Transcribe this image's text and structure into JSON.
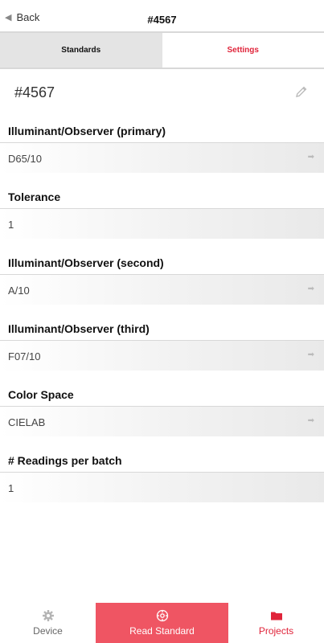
{
  "header": {
    "back_label": "Back",
    "title": "#4567"
  },
  "tabs": [
    {
      "label": "Standards",
      "active": false
    },
    {
      "label": "Settings",
      "active": true
    }
  ],
  "standard": {
    "name": "#4567"
  },
  "settings": [
    {
      "label": "Illuminant/Observer (primary)",
      "value": "D65/10",
      "has_arrow": true
    },
    {
      "label": "Tolerance",
      "value": "1",
      "has_arrow": false
    },
    {
      "label": "Illuminant/Observer (second)",
      "value": "A/10",
      "has_arrow": true
    },
    {
      "label": "Illuminant/Observer (third)",
      "value": "F07/10",
      "has_arrow": true
    },
    {
      "label": "Color Space",
      "value": "CIELAB",
      "has_arrow": true
    },
    {
      "label": "# Readings per batch",
      "value": "1",
      "has_arrow": false
    }
  ],
  "bottom_nav": {
    "device_label": "Device",
    "read_label": "Read Standard",
    "projects_label": "Projects"
  },
  "colors": {
    "accent": "#e0243a",
    "read_button": "#ef5563",
    "tab_inactive_bg": "#e4e4e4"
  }
}
